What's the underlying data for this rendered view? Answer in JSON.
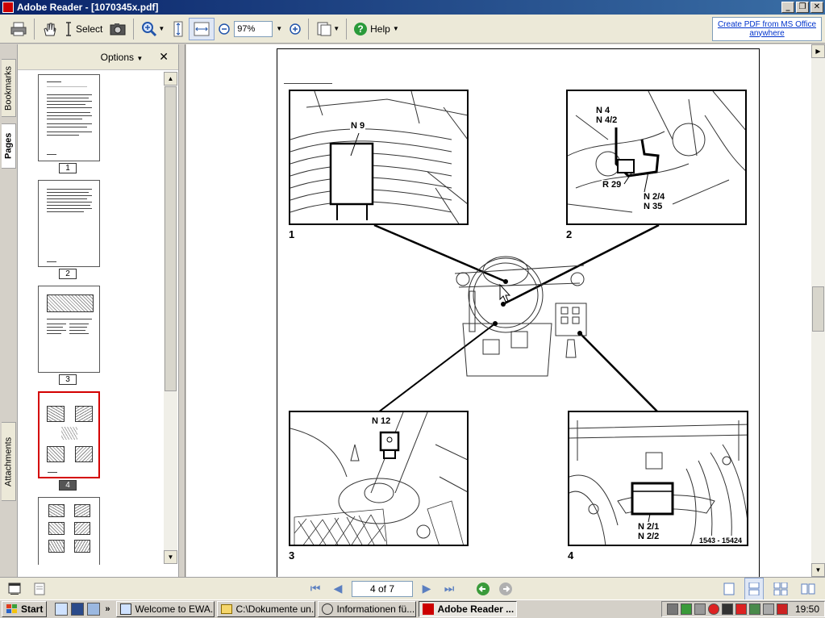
{
  "window": {
    "title": "Adobe Reader - [1070345x.pdf]"
  },
  "toolbar": {
    "select_label": "Select",
    "zoom_value": "97%",
    "help_label": "Help",
    "create_pdf_line1": "Create PDF from MS Office",
    "create_pdf_line2": "anywhere"
  },
  "nav": {
    "options_label": "Options",
    "tabs": [
      "Bookmarks",
      "Pages",
      "Attachments"
    ],
    "thumbnails": [
      "1",
      "2",
      "3",
      "4"
    ],
    "selected_page": "4"
  },
  "figure": {
    "panel_numbers": [
      "1",
      "2",
      "3",
      "4"
    ],
    "callouts": {
      "n9": "N 9",
      "n4": "N 4",
      "n42": "N 4/2",
      "r29": "R 29",
      "n24": "N 2/4",
      "n35": "N 35",
      "n12": "N 12",
      "n21": "N 2/1",
      "n22": "N 2/2",
      "ref": "1543 - 15424"
    }
  },
  "status": {
    "page_indicator": "4 of 7"
  },
  "taskbar": {
    "start_label": "Start",
    "more": "»",
    "tasks": [
      "Welcome to EWA...",
      "C:\\Dokumente un...",
      "Informationen fü...",
      "Adobe Reader ..."
    ],
    "clock": "19:50"
  }
}
